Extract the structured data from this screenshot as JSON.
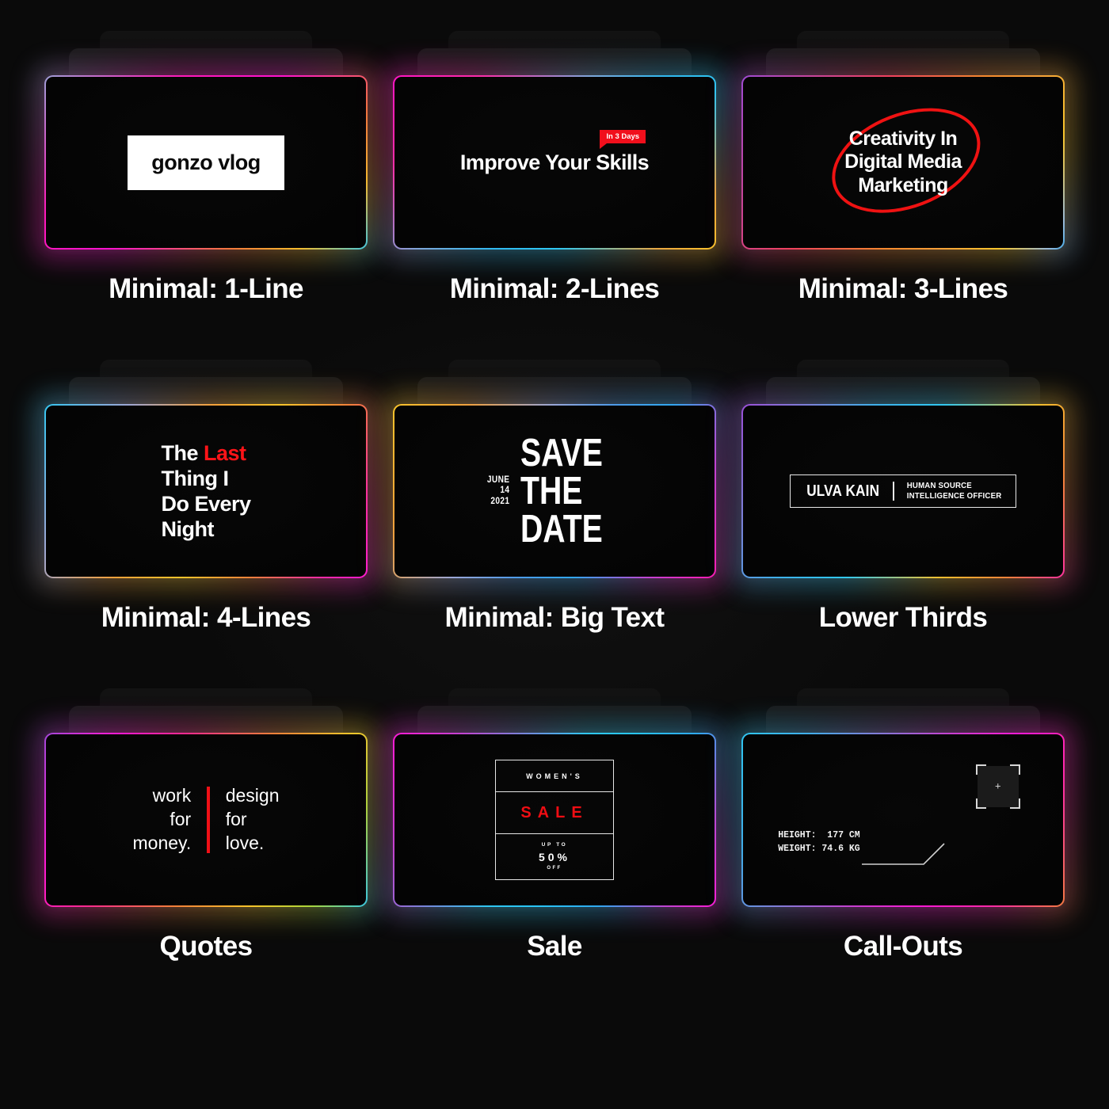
{
  "page": {
    "background": "#0b0b0b",
    "columns": 3,
    "rows": 3
  },
  "palette": {
    "red": "#ef1212",
    "white": "#ffffff",
    "magenta": "#ff18d6",
    "cyan": "#29c5f6",
    "orange": "#f58b2d",
    "yellow": "#f7c62b",
    "purple": "#9d4bd8"
  },
  "cards": [
    {
      "caption": "Minimal: 1-Line",
      "gradient": "linear-gradient(135deg, #9aa6d8 0%, #ff19b9 28%, #ff12d0 48%, #f27a3a 72%, #f5c02c 86%, #2fc8f2 100%)",
      "content": {
        "plate_text": "gonzo vlog"
      }
    },
    {
      "caption": "Minimal: 2-Lines",
      "gradient": "linear-gradient(135deg, #ff14c8 0%, #ff2aa8 18%, #7fa7d9 40%, #2fb9f0 55%, #2fc8f2 68%, #f2a63a 88%, #f7c62b 100%)",
      "content": {
        "title": "Improve Your Skills",
        "badge": "In 3 Days"
      }
    },
    {
      "caption": "Minimal: 3-Lines",
      "gradient": "linear-gradient(120deg, #9d4bd8 0%, #f0405f 35%, #f58b2d 58%, #f5a03a 70%, #f7c62b 84%, #8fb7e8 96%, #2fa8f0 100%)",
      "content": {
        "lines": [
          "Creativity In",
          "Digital Media",
          "Marketing"
        ],
        "circle_color": "#ef1212"
      }
    },
    {
      "caption": "Minimal: 4-Lines",
      "gradient": "linear-gradient(120deg, #2fc8f2 0%, #9aa6d8 20%, #f5a03a 40%, #f7c62b 56%, #f2803a 72%, #ff2aa8 88%, #ff18d6 100%)",
      "content": {
        "line1_a": "The ",
        "line1_b": "Last",
        "line2": "Thing I",
        "line3": "Do Every",
        "line4": "Night"
      }
    },
    {
      "caption": "Minimal: Big Text",
      "gradient": "linear-gradient(120deg, #f7c62b 0%, #f2a03a 18%, #9aa6d8 38%, #4f9ae8 52%, #2fa8f0 66%, #c93fd0 84%, #ff18b0 100%)",
      "content": {
        "date_lines": [
          "JUNE",
          "14",
          "2021"
        ],
        "big_lines": [
          "SAVE",
          "THE",
          "DATE"
        ]
      }
    },
    {
      "caption": "Lower Thirds",
      "gradient": "linear-gradient(120deg, #9d4bd8 0%, #7f7fd8 16%, #3fb0ea 32%, #2fc8f2 48%, #f5c02c 70%, #f2803a 86%, #ff2aa8 100%)",
      "content": {
        "name": "ULVA KAIN",
        "role_lines": [
          "HUMAN SOURCE",
          "INTELLIGENCE OFFICER"
        ]
      }
    },
    {
      "caption": "Quotes",
      "gradient": "linear-gradient(120deg, #9d4bd8 0%, #ff18d6 18%, #ff2a8f 34%, #f2803a 54%, #f7c62b 72%, #a8d63a 86%, #2fc8f2 100%)",
      "content": {
        "left_lines": [
          "work",
          "for",
          "money."
        ],
        "right_lines": [
          "design",
          "for",
          "love."
        ],
        "rule_color": "#f01016"
      }
    },
    {
      "caption": "Sale",
      "gradient": "linear-gradient(120deg, #ff18d6 0%, #c93fd0 16%, #7f7fd8 30%, #2fc8f2 46%, #29c5f6 58%, #2fa8f0 72%, #c93fd0 88%, #ff18d6 100%)",
      "content": {
        "row1": "WOMEN'S",
        "row2": "SALE",
        "row3_a": "UP TO",
        "row3_b": "50%",
        "row3_c": "OFF"
      }
    },
    {
      "caption": "Call-Outs",
      "gradient": "linear-gradient(120deg, #2fc8f2 0%, #3fb0ea 16%, #7f7fd8 32%, #c93fd0 50%, #ff18d6 66%, #ff2aa8 82%, #f2803a 100%)",
      "content": {
        "readout": "HEIGHT:  177 CM\nWEIGHT: 74.6 KG",
        "target_marker": "+"
      }
    }
  ]
}
